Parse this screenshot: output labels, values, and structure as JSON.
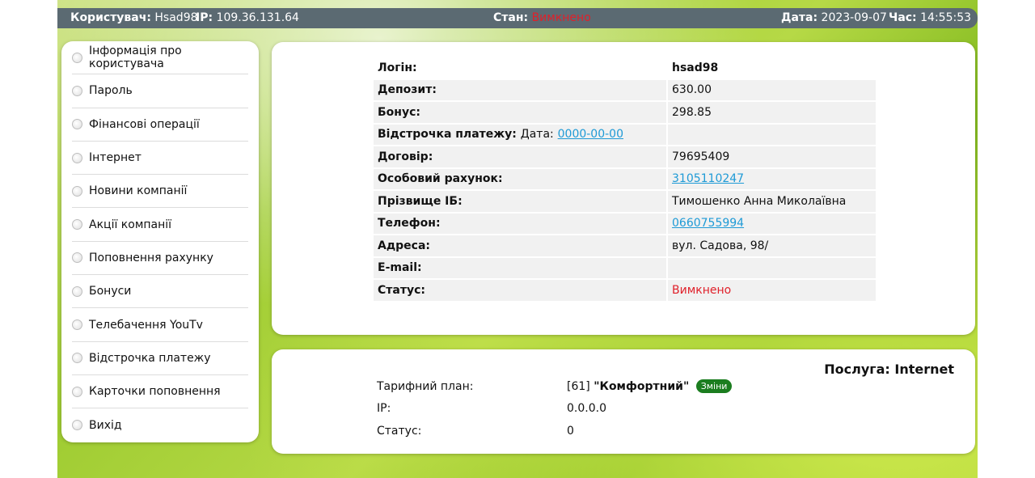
{
  "header": {
    "user_label": "Користувач:",
    "user_value": "Hsad98",
    "ip_label": "IP:",
    "ip_value": "109.36.131.64",
    "state_label": "Стан:",
    "state_value": "Вимкнено",
    "date_label": "Дата:",
    "date_value": "2023-09-07",
    "time_label": "Час:",
    "time_value": "14:55:53"
  },
  "sidebar": {
    "items": [
      {
        "label": "Інформація про користувача"
      },
      {
        "label": "Пароль"
      },
      {
        "label": "Фінансові операції"
      },
      {
        "label": "Інтернет"
      },
      {
        "label": "Новини компанії"
      },
      {
        "label": "Акції компанії"
      },
      {
        "label": "Поповнення рахунку"
      },
      {
        "label": "Бонуси"
      },
      {
        "label": "Телебачення YouTv"
      },
      {
        "label": "Відстрочка платежу"
      },
      {
        "label": "Карточки поповнення"
      },
      {
        "label": "Вихід"
      }
    ]
  },
  "info": {
    "login_label": "Логін:",
    "login_value": "hsad98",
    "deposit_label": "Депозит:",
    "deposit_value": "630.00",
    "bonus_label": "Бонус:",
    "bonus_value": "298.85",
    "deferral_label": "Відстрочка платежу:",
    "deferral_date_label": "Дата:",
    "deferral_date_value": "0000-00-00",
    "contract_label": "Договір:",
    "contract_value": "79695409",
    "account_label": "Особовий рахунок:",
    "account_value": "3105110247",
    "name_label": "Прізвище ІБ:",
    "name_value": "Тимошенко Анна Миколаївна",
    "phone_label": "Телефон:",
    "phone_value": "0660755994",
    "address_label": "Адреса:",
    "address_value": "вул. Садова, 98/",
    "email_label": "E-mail:",
    "email_value": "",
    "status_label": "Статус:",
    "status_value": "Вимкнено"
  },
  "service": {
    "title": "Послуга: Internet",
    "tariff_label": "Тарифний план:",
    "tariff_id": "[61]",
    "tariff_name": "\"Комфортний\"",
    "change_button": "Зміни",
    "ip_label": "IP:",
    "ip_value": "0.0.0.0",
    "status_label": "Статус:",
    "status_value": "0"
  },
  "colors": {
    "off_red": "#e0202a",
    "link_blue": "#1e9ad6",
    "badge_green": "#1b7d1f",
    "topbar_gray": "#5b6a72"
  }
}
